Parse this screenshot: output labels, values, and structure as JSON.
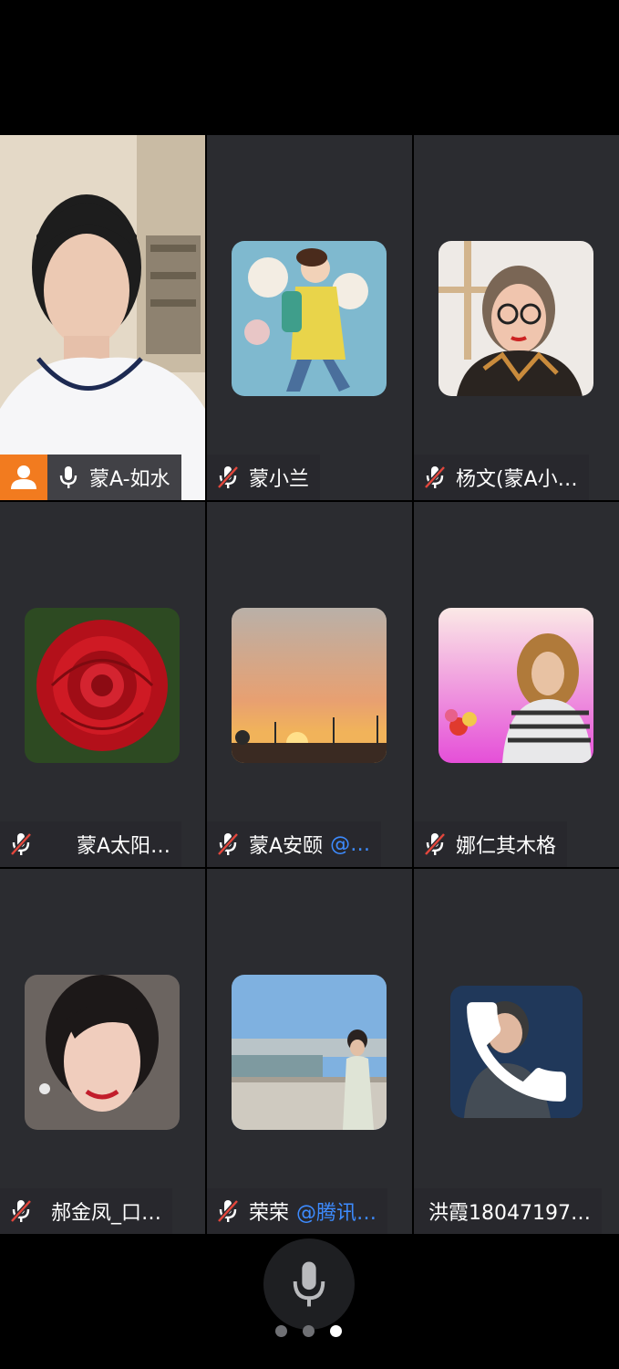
{
  "participants": [
    {
      "name": "蒙A-如水",
      "tag": "",
      "mic": "on",
      "host": true,
      "video": true
    },
    {
      "name": "蒙小兰",
      "tag": "",
      "mic": "muted"
    },
    {
      "name": "杨文(蒙A小…",
      "tag": "",
      "mic": "muted"
    },
    {
      "name": "蒙A太阳…",
      "tag": "",
      "mic": "muted"
    },
    {
      "name": "蒙A安颐",
      "tag": "@…",
      "mic": "muted"
    },
    {
      "name": "娜仁其木格",
      "tag": "",
      "mic": "muted"
    },
    {
      "name": "郝金凤_口…",
      "tag": "",
      "mic": "muted"
    },
    {
      "name": "荣荣",
      "tag": "@腾讯…",
      "mic": "muted"
    },
    {
      "name": "洪霞18047197…",
      "tag": "",
      "mic": "phone"
    }
  ],
  "colors": {
    "host_badge": "#f27b1f",
    "tag_link": "#3d8bff",
    "tile_bg": "#2b2c30"
  },
  "pager": {
    "pages": 3,
    "current": 3
  },
  "icons": {
    "mic": "microphone-icon",
    "muted": "mic-muted-icon",
    "host": "host-user-icon",
    "phone": "phone-icon"
  }
}
